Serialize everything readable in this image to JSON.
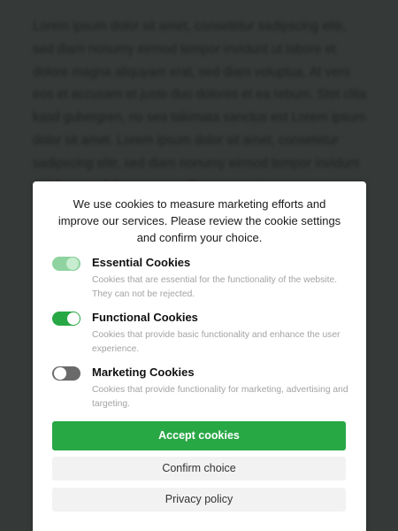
{
  "background": {
    "text": "Lorem ipsum dolor sit amet, consetetur sadipscing elitr, sed diam nonumy eirmod tempor invidunt ut labore et dolore magna aliquyam erat, sed diam voluptua. At vero eos et accusam et justo duo dolores et ea rebum. Stet clita kasd gubergren, no sea takimata sanctus est Lorem ipsum dolor sit amet. Lorem ipsum dolor sit amet, consetetur sadipscing elitr, sed diam nonumy eirmod tempor invidunt ut labore et dolore magna aliquyam erat"
  },
  "banner": {
    "intro": "We use cookies to measure marketing efforts and improve our services. Please review the cookie settings and confirm your choice.",
    "options": [
      {
        "title": "Essential Cookies",
        "description": "Cookies that are essential for the functionality of the website. They can not be rejected.",
        "state": "on, disabled"
      },
      {
        "title": "Functional Cookies",
        "description": "Cookies that provide basic functionality and enhance the user experience.",
        "state": "on"
      },
      {
        "title": "Marketing Cookies",
        "description": "Cookies that provide functionality for marketing, advertising and targeting.",
        "state": "off"
      }
    ],
    "accept_label": "Accept cookies",
    "confirm_label": "Confirm choice",
    "privacy_label": "Privacy policy"
  },
  "colors": {
    "accent": "#28a745",
    "overlay": "#353937",
    "toggle_off": "#6a6a6a",
    "button_secondary": "#f2f2f2"
  }
}
